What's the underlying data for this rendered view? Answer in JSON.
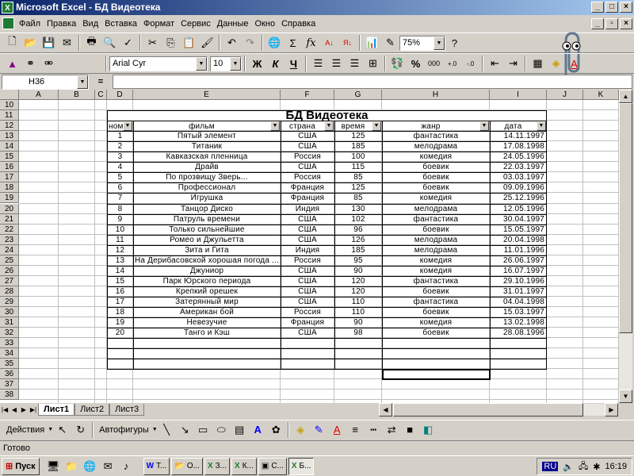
{
  "window": {
    "title": "Microsoft Excel - БД Видеотека"
  },
  "menu": [
    "Файл",
    "Правка",
    "Вид",
    "Вставка",
    "Формат",
    "Сервис",
    "Данные",
    "Окно",
    "Справка"
  ],
  "toolbar": {
    "zoom": "75%",
    "font": "Arial Cyr",
    "font_size": "10",
    "bold": "Ж",
    "italic": "К",
    "underline": "Ч",
    "percent": "%",
    "thousands": "000"
  },
  "namebox": "H36",
  "columns": [
    "A",
    "B",
    "C",
    "D",
    "E",
    "F",
    "G",
    "H",
    "I",
    "J",
    "K"
  ],
  "rows": [
    "10",
    "11",
    "12",
    "13",
    "14",
    "15",
    "16",
    "17",
    "18",
    "19",
    "20",
    "21",
    "22",
    "23",
    "24",
    "25",
    "26",
    "27",
    "28",
    "29",
    "30",
    "31",
    "32",
    "33",
    "34",
    "35",
    "36",
    "37",
    "38"
  ],
  "table": {
    "title": "БД Видеотека",
    "headers": [
      "ном",
      "фильм",
      "страна",
      "время",
      "жанр",
      "дата"
    ],
    "records": [
      [
        "1",
        "Пятый элемент",
        "США",
        "125",
        "фантастика",
        "14.11.1997"
      ],
      [
        "2",
        "Титаник",
        "США",
        "185",
        "мелодрама",
        "17.08.1998"
      ],
      [
        "3",
        "Кавказская пленница",
        "Россия",
        "100",
        "комедия",
        "24.05.1996"
      ],
      [
        "4",
        "Драйв",
        "США",
        "115",
        "боевик",
        "22.03.1997"
      ],
      [
        "5",
        "По прозвищу Зверь...",
        "Россия",
        "85",
        "боевик",
        "03.03.1997"
      ],
      [
        "6",
        "Профессионал",
        "Франция",
        "125",
        "боевик",
        "09.09.1996"
      ],
      [
        "7",
        "Игрушка",
        "Франция",
        "85",
        "комедия",
        "25.12.1996"
      ],
      [
        "8",
        "Танцор Диско",
        "Индия",
        "130",
        "мелодрама",
        "12.05.1996"
      ],
      [
        "9",
        "Патруль времени",
        "США",
        "102",
        "фантастика",
        "30.04.1997"
      ],
      [
        "10",
        "Только сильнейшие",
        "США",
        "96",
        "боевик",
        "15.05.1997"
      ],
      [
        "11",
        "Ромео и Джульетта",
        "США",
        "126",
        "мелодрама",
        "20.04.1998"
      ],
      [
        "12",
        "Зита и Гита",
        "Индия",
        "185",
        "мелодрама",
        "11.01.1996"
      ],
      [
        "13",
        "На Дерибасовской хорошая погода ...",
        "Россия",
        "95",
        "комедия",
        "26.06.1997"
      ],
      [
        "14",
        "Джуниор",
        "США",
        "90",
        "комедия",
        "16.07.1997"
      ],
      [
        "15",
        "Парк Юрского периода",
        "США",
        "120",
        "фантастика",
        "29.10.1996"
      ],
      [
        "16",
        "Крепкий орешек",
        "США",
        "120",
        "боевик",
        "31.01.1997"
      ],
      [
        "17",
        "Затерянный мир",
        "США",
        "110",
        "фантастика",
        "04.04.1998"
      ],
      [
        "18",
        "Американ бой",
        "Россия",
        "110",
        "боевик",
        "15.03.1997"
      ],
      [
        "19",
        "Невезучие",
        "Франция",
        "90",
        "комедия",
        "13.02.1998"
      ],
      [
        "20",
        "Танго и Кэш",
        "США",
        "98",
        "боевик",
        "28.08.1996"
      ]
    ]
  },
  "sheets": [
    "Лист1",
    "Лист2",
    "Лист3"
  ],
  "drawing": {
    "actions": "Действия",
    "autoshapes": "Автофигуры"
  },
  "status": "Готово",
  "taskbar": {
    "start": "Пуск",
    "items": [
      "Т...",
      "О...",
      "З...",
      "К...",
      "С...",
      "Б..."
    ],
    "lang": "RU",
    "clock": "16:19"
  },
  "colors": {
    "title_bar": "#0a246a",
    "excel_green": "#1e7b34"
  }
}
